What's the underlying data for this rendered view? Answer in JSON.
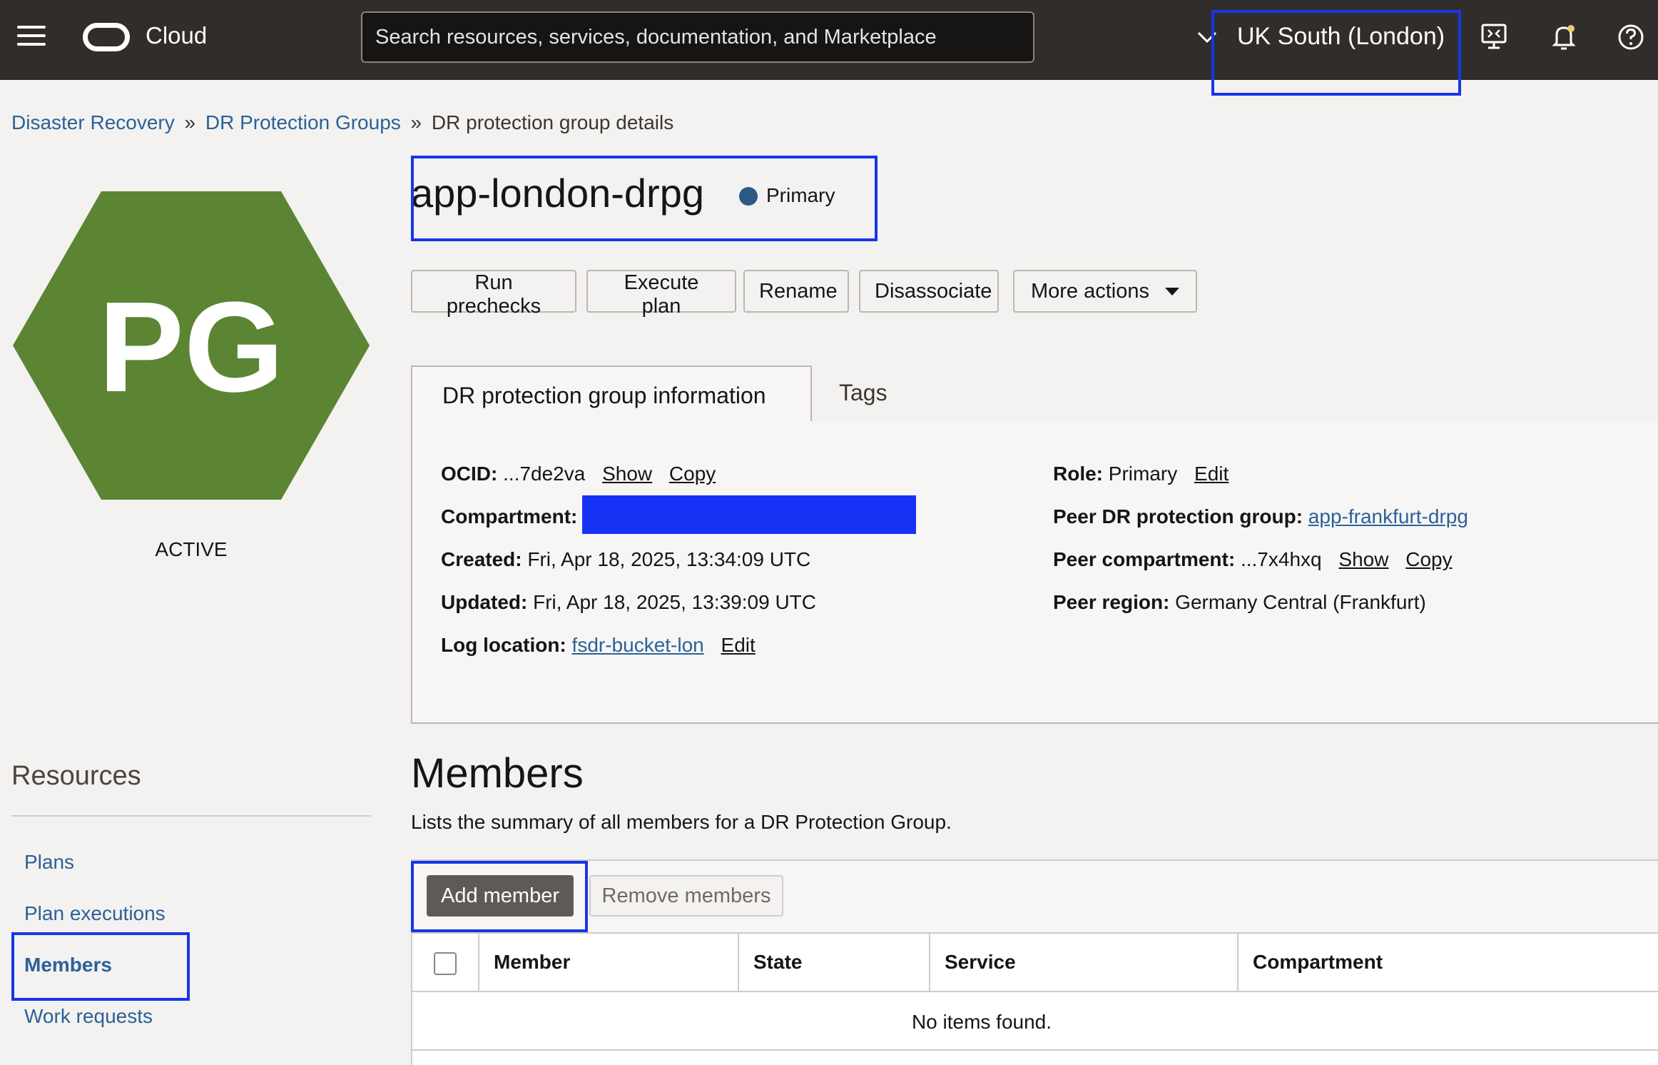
{
  "header": {
    "brand": "Cloud",
    "search_placeholder": "Search resources, services, documentation, and Marketplace",
    "region": "UK South (London)"
  },
  "breadcrumb": {
    "items": [
      "Disaster Recovery",
      "DR Protection Groups"
    ],
    "current": "DR protection group details",
    "separator": "»"
  },
  "resource": {
    "initials": "PG",
    "status": "ACTIVE",
    "hex_color": "#5b8533",
    "name": "app-london-drpg",
    "role_badge": "Primary"
  },
  "actions": [
    "Run prechecks",
    "Execute plan",
    "Rename",
    "Disassociate",
    "More actions"
  ],
  "tabs": [
    "DR protection group information",
    "Tags"
  ],
  "info": {
    "ocid_label": "OCID:",
    "ocid_value": "...7de2va",
    "show": "Show",
    "copy": "Copy",
    "compartment_label": "Compartment:",
    "created_label": "Created:",
    "created_value": "Fri, Apr 18, 2025, 13:34:09 UTC",
    "updated_label": "Updated:",
    "updated_value": "Fri, Apr 18, 2025, 13:39:09 UTC",
    "log_label": "Log location:",
    "log_value": "fsdr-bucket-lon",
    "edit": "Edit",
    "role_label": "Role:",
    "role_value": "Primary",
    "peer_group_label": "Peer DR protection group:",
    "peer_group_value": "app-frankfurt-drpg",
    "peer_compartment_label": "Peer compartment:",
    "peer_compartment_value": "...7x4hxq",
    "peer_region_label": "Peer region:",
    "peer_region_value": "Germany Central (Frankfurt)"
  },
  "resources_nav": {
    "title": "Resources",
    "items": [
      "Plans",
      "Plan executions",
      "Members",
      "Work requests"
    ],
    "active": "Members"
  },
  "members": {
    "title": "Members",
    "description": "Lists the summary of all members for a DR Protection Group.",
    "add_button": "Add member",
    "remove_button": "Remove members",
    "columns": [
      "Member",
      "State",
      "Service",
      "Compartment"
    ],
    "empty_message": "No items found."
  },
  "colors": {
    "accent_link": "#2b6198",
    "highlight_box": "#1536e8",
    "topbar": "#312d2a",
    "status_dot": "#2b5b84"
  }
}
